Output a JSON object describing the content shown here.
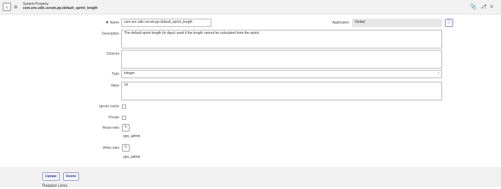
{
  "header": {
    "title": "System Property",
    "record_name": "com.snc.sdlc.scrum.pp.default_sprint_length",
    "icons": [
      "back-icon",
      "menu-icon",
      "attachment-icon",
      "flow-icon",
      "settings-icon"
    ]
  },
  "form": {
    "name": {
      "label": "Name",
      "required_mark": "✱",
      "value": "com.snc.sdlc.scrum.pp.default_sprint_length"
    },
    "application": {
      "label": "Application",
      "value": "Global"
    },
    "description": {
      "label": "Description",
      "value": "The default sprint length (in days) used if the length cannot be calculated from the sprint."
    },
    "choices": {
      "label": "Choices",
      "value": ""
    },
    "type": {
      "label": "Type",
      "value": "integer"
    },
    "value": {
      "label": "Value",
      "value": "14"
    },
    "ignore_cache": {
      "label": "Ignore cache",
      "checked": false
    },
    "private": {
      "label": "Private",
      "checked": false
    },
    "read_roles": {
      "label": "Read roles",
      "value": "pps_admin"
    },
    "write_roles": {
      "label": "Write roles",
      "value": "pps_admin"
    }
  },
  "footer": {
    "update_label": "Update",
    "delete_label": "Delete",
    "related_links": "Related Links"
  }
}
